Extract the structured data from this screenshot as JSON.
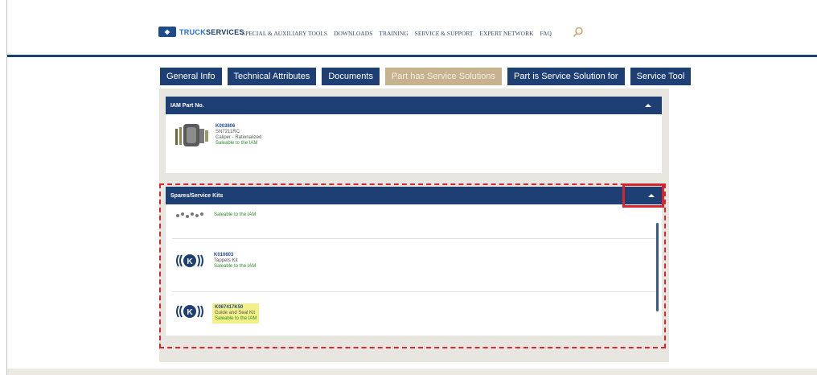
{
  "header": {
    "logo_mark": "◈",
    "logo_text_a": "TRUCK",
    "logo_text_b": "SERVICES",
    "nav": [
      "SPECIAL & AUXILIARY TOOLS",
      "DOWNLOADS",
      "TRAINING",
      "SERVICE & SUPPORT",
      "EXPERT NETWORK",
      "FAQ"
    ]
  },
  "tabs": [
    {
      "label": "General Info",
      "active": false
    },
    {
      "label": "Technical Attributes",
      "active": false
    },
    {
      "label": "Documents",
      "active": false
    },
    {
      "label": "Part has Service Solutions",
      "active": true
    },
    {
      "label": "Part is Service Solution for",
      "active": false
    },
    {
      "label": "Service Tool",
      "active": false
    }
  ],
  "iam_section": {
    "title": "IAM Part No.",
    "item": {
      "part_no": "K003806",
      "ref": "SN7211RC",
      "desc": "Caliper - Rationalized",
      "sale": "Saleable to the IAM"
    }
  },
  "spares_section": {
    "title": "Spares/Service Kits",
    "items": [
      {
        "part_no": "",
        "desc": "",
        "sale": "Saleable to the IAM"
      },
      {
        "part_no": "K010603",
        "desc": "Tappets Kit",
        "sale": "Saleable to the IAM"
      },
      {
        "part_no": "K067417K50",
        "desc": "Guide and Seal Kit",
        "sale": "Saleable to the IAM"
      }
    ]
  },
  "colors": {
    "navy": "#1e3f73",
    "active_tab": "#c7b28f",
    "highlight_red": "#d9262c",
    "saleable_green": "#2e8b2e"
  }
}
